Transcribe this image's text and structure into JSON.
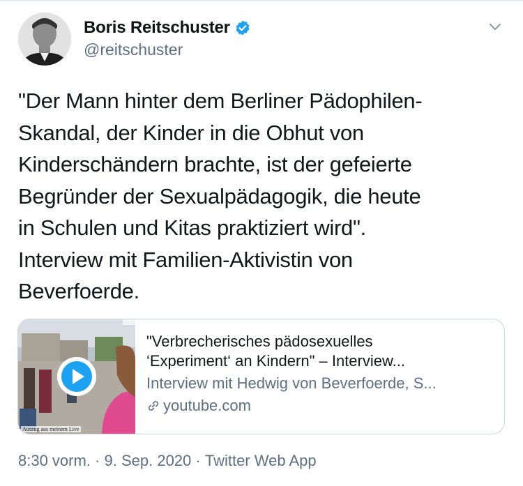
{
  "tweet": {
    "display_name": "Boris Reitschuster",
    "handle": "@reitschuster",
    "verified": true,
    "text": "\"Der Mann hinter dem Berliner Pädophilen-\nSkandal, der Kinder in die Obhut von\nKinderschändern brachte, ist der gefeierte\nBegründer der Sexualpädagogik, die heute\nin Schulen und Kitas praktiziert wird\".\nInterview mit Familien-Aktivistin von\nBeverfoerde."
  },
  "card": {
    "title_line1": "\"Verbrecherisches pädosexuelles",
    "title_line2": "‘Experiment‘ an Kindern\" – Interview...",
    "description": "Interview mit Hedwig von Beverfoerde, S...",
    "domain": "youtube.com",
    "thumb_caption": "Auszug aus meinem Live"
  },
  "meta": {
    "time": "8:30 vorm.",
    "separator1": " · ",
    "date": "9. Sep. 2020",
    "separator2": " · ",
    "source": "Twitter Web App"
  },
  "colors": {
    "accent": "#1da1f2",
    "secondary_text": "#5b7083",
    "border": "#ccd6dd"
  },
  "icons": [
    "verified-badge-icon",
    "chevron-down-icon",
    "play-icon",
    "link-icon"
  ]
}
